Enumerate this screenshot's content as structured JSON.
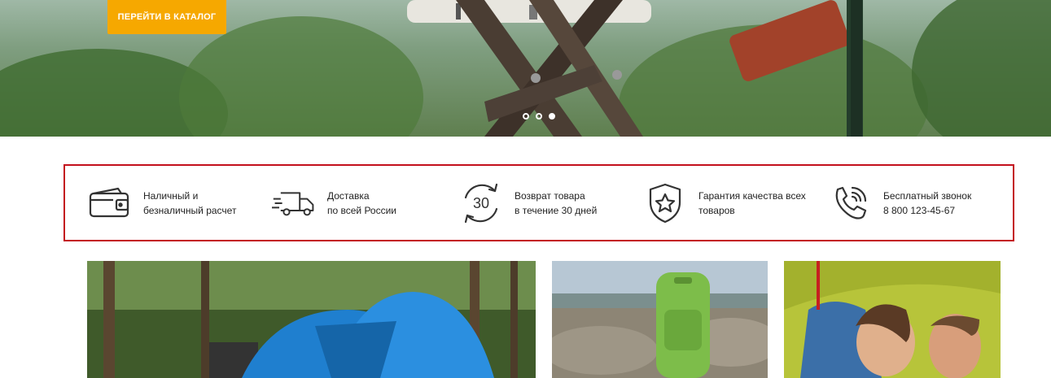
{
  "hero": {
    "cta_label": "ПЕРЕЙТИ В КАТАЛОГ",
    "slider_dots": [
      {
        "active": false
      },
      {
        "active": false
      },
      {
        "active": true
      }
    ]
  },
  "features": [
    {
      "icon": "wallet-icon",
      "line1": "Наличный и",
      "line2": "безналичный расчет"
    },
    {
      "icon": "truck-icon",
      "line1": "Доставка",
      "line2": "по всей России"
    },
    {
      "icon": "return-30-icon",
      "icon_text": "30",
      "line1": "Возврат товара",
      "line2": "в течение 30 дней"
    },
    {
      "icon": "shield-star-icon",
      "line1": "Гарантия качества всех",
      "line2": "товаров"
    },
    {
      "icon": "phone-icon",
      "line1": "Бесплатный звонок",
      "line2": "8 800 123-45-67"
    }
  ],
  "colors": {
    "accent": "#f6a800",
    "highlight_border": "#c30f1c",
    "icon": "#333333"
  }
}
